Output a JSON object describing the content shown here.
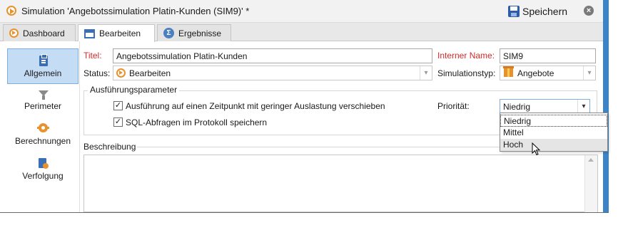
{
  "window": {
    "title": "Simulation 'Angebotssimulation Platin-Kunden (SIM9)' *",
    "save_label": "Speichern",
    "close_symbol": "×"
  },
  "tabs": [
    {
      "label": "Dashboard",
      "icon": "play-circle-icon",
      "active": false
    },
    {
      "label": "Bearbeiten",
      "icon": "edit-window-icon",
      "active": true
    },
    {
      "label": "Ergebnisse",
      "icon": "sigma-icon",
      "active": false
    }
  ],
  "sidebar": {
    "items": [
      {
        "label": "Allgemein",
        "icon": "clipboard-icon",
        "active": true
      },
      {
        "label": "Perimeter",
        "icon": "funnel-icon",
        "active": false
      },
      {
        "label": "Berechnungen",
        "icon": "gear-icon",
        "active": false
      },
      {
        "label": "Verfolgung",
        "icon": "tracking-icon",
        "active": false
      }
    ]
  },
  "form": {
    "title_label": "Titel:",
    "title_value": "Angebotssimulation Platin-Kunden",
    "internal_name_label": "Interner Name:",
    "internal_name_value": "SIM9",
    "status_label": "Status:",
    "status_value": "Bearbeiten",
    "simulation_type_label": "Simulationstyp:",
    "simulation_type_value": "Angebote",
    "params_group_title": "Ausführungsparameter",
    "option_defer_label": "Ausführung auf einen Zeitpunkt mit geringer Auslastung verschieben",
    "option_defer_checked": true,
    "option_sql_label": "SQL-Abfragen im Protokoll speichern",
    "option_sql_checked": true,
    "priority_label": "Priorität:",
    "priority_value": "Niedrig",
    "priority_options": [
      "Niedrig",
      "Mittel",
      "Hoch"
    ],
    "priority_hovered": "Hoch",
    "description_label": "Beschreibung",
    "description_value": ""
  },
  "colors": {
    "mandatory_label": "#d42a2a",
    "accent_orange": "#e8922d",
    "sidebar_active": "#c5dcf5",
    "window_edge": "#3c84c8"
  }
}
